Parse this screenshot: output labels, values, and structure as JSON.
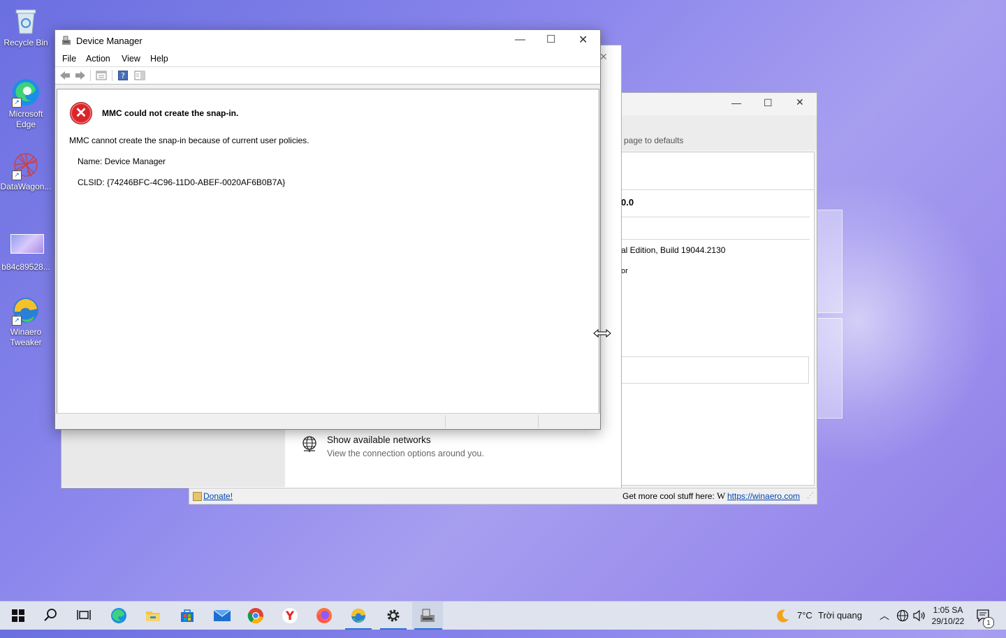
{
  "desktop": {
    "icons": [
      {
        "label": "Recycle Bin"
      },
      {
        "label": "Microsoft Edge"
      },
      {
        "label": "DataWagon..."
      },
      {
        "label": "b84c89528..."
      },
      {
        "label": "Winaero Tweaker"
      }
    ]
  },
  "winaero": {
    "reset_text": "page to defaults",
    "version_fragment": "0.0",
    "edition_text": "al Edition, Build 19044.2130",
    "or_text": "or",
    "network_title": "Show available networks",
    "network_desc": "View the connection options around you.",
    "donate_label": "Donate!",
    "more_text": "Get more cool stuff here:",
    "site_link": "https://winaero.com"
  },
  "device_manager": {
    "title": "Device Manager",
    "menu": [
      "File",
      "Action",
      "View",
      "Help"
    ],
    "error": {
      "heading": "MMC could not create the snap-in.",
      "message": "MMC cannot create the snap-in because of current user policies.",
      "name_line": "Name: Device Manager",
      "clsid_line": "CLSID: {74246BFC-4C96-11D0-ABEF-0020AF6B0B7A}"
    }
  },
  "taskbar": {
    "weather_temp": "7°C",
    "weather_text": "Trời quang",
    "time": "1:05 SA",
    "date": "29/10/22",
    "notification_count": "1"
  },
  "colors": {
    "accent": "#2f6fd6",
    "error_red": "#d9252a"
  }
}
